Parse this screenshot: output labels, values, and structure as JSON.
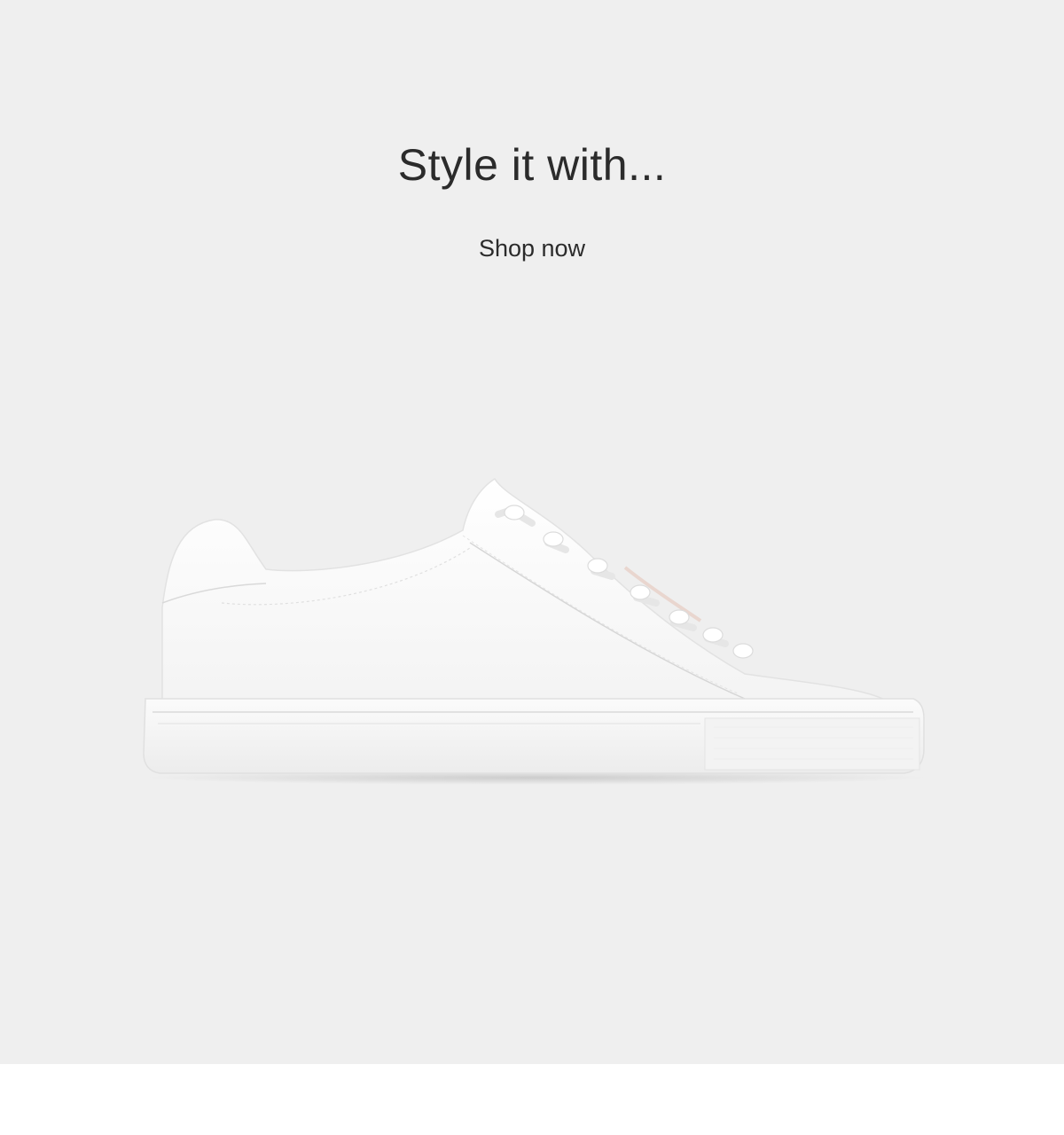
{
  "banner": {
    "headline": "Style it with...",
    "cta_label": "Shop now",
    "background_color": "#efefef",
    "text_color": "#2b2b2b"
  },
  "product": {
    "image_icon": "white-leather-sneaker-icon"
  }
}
